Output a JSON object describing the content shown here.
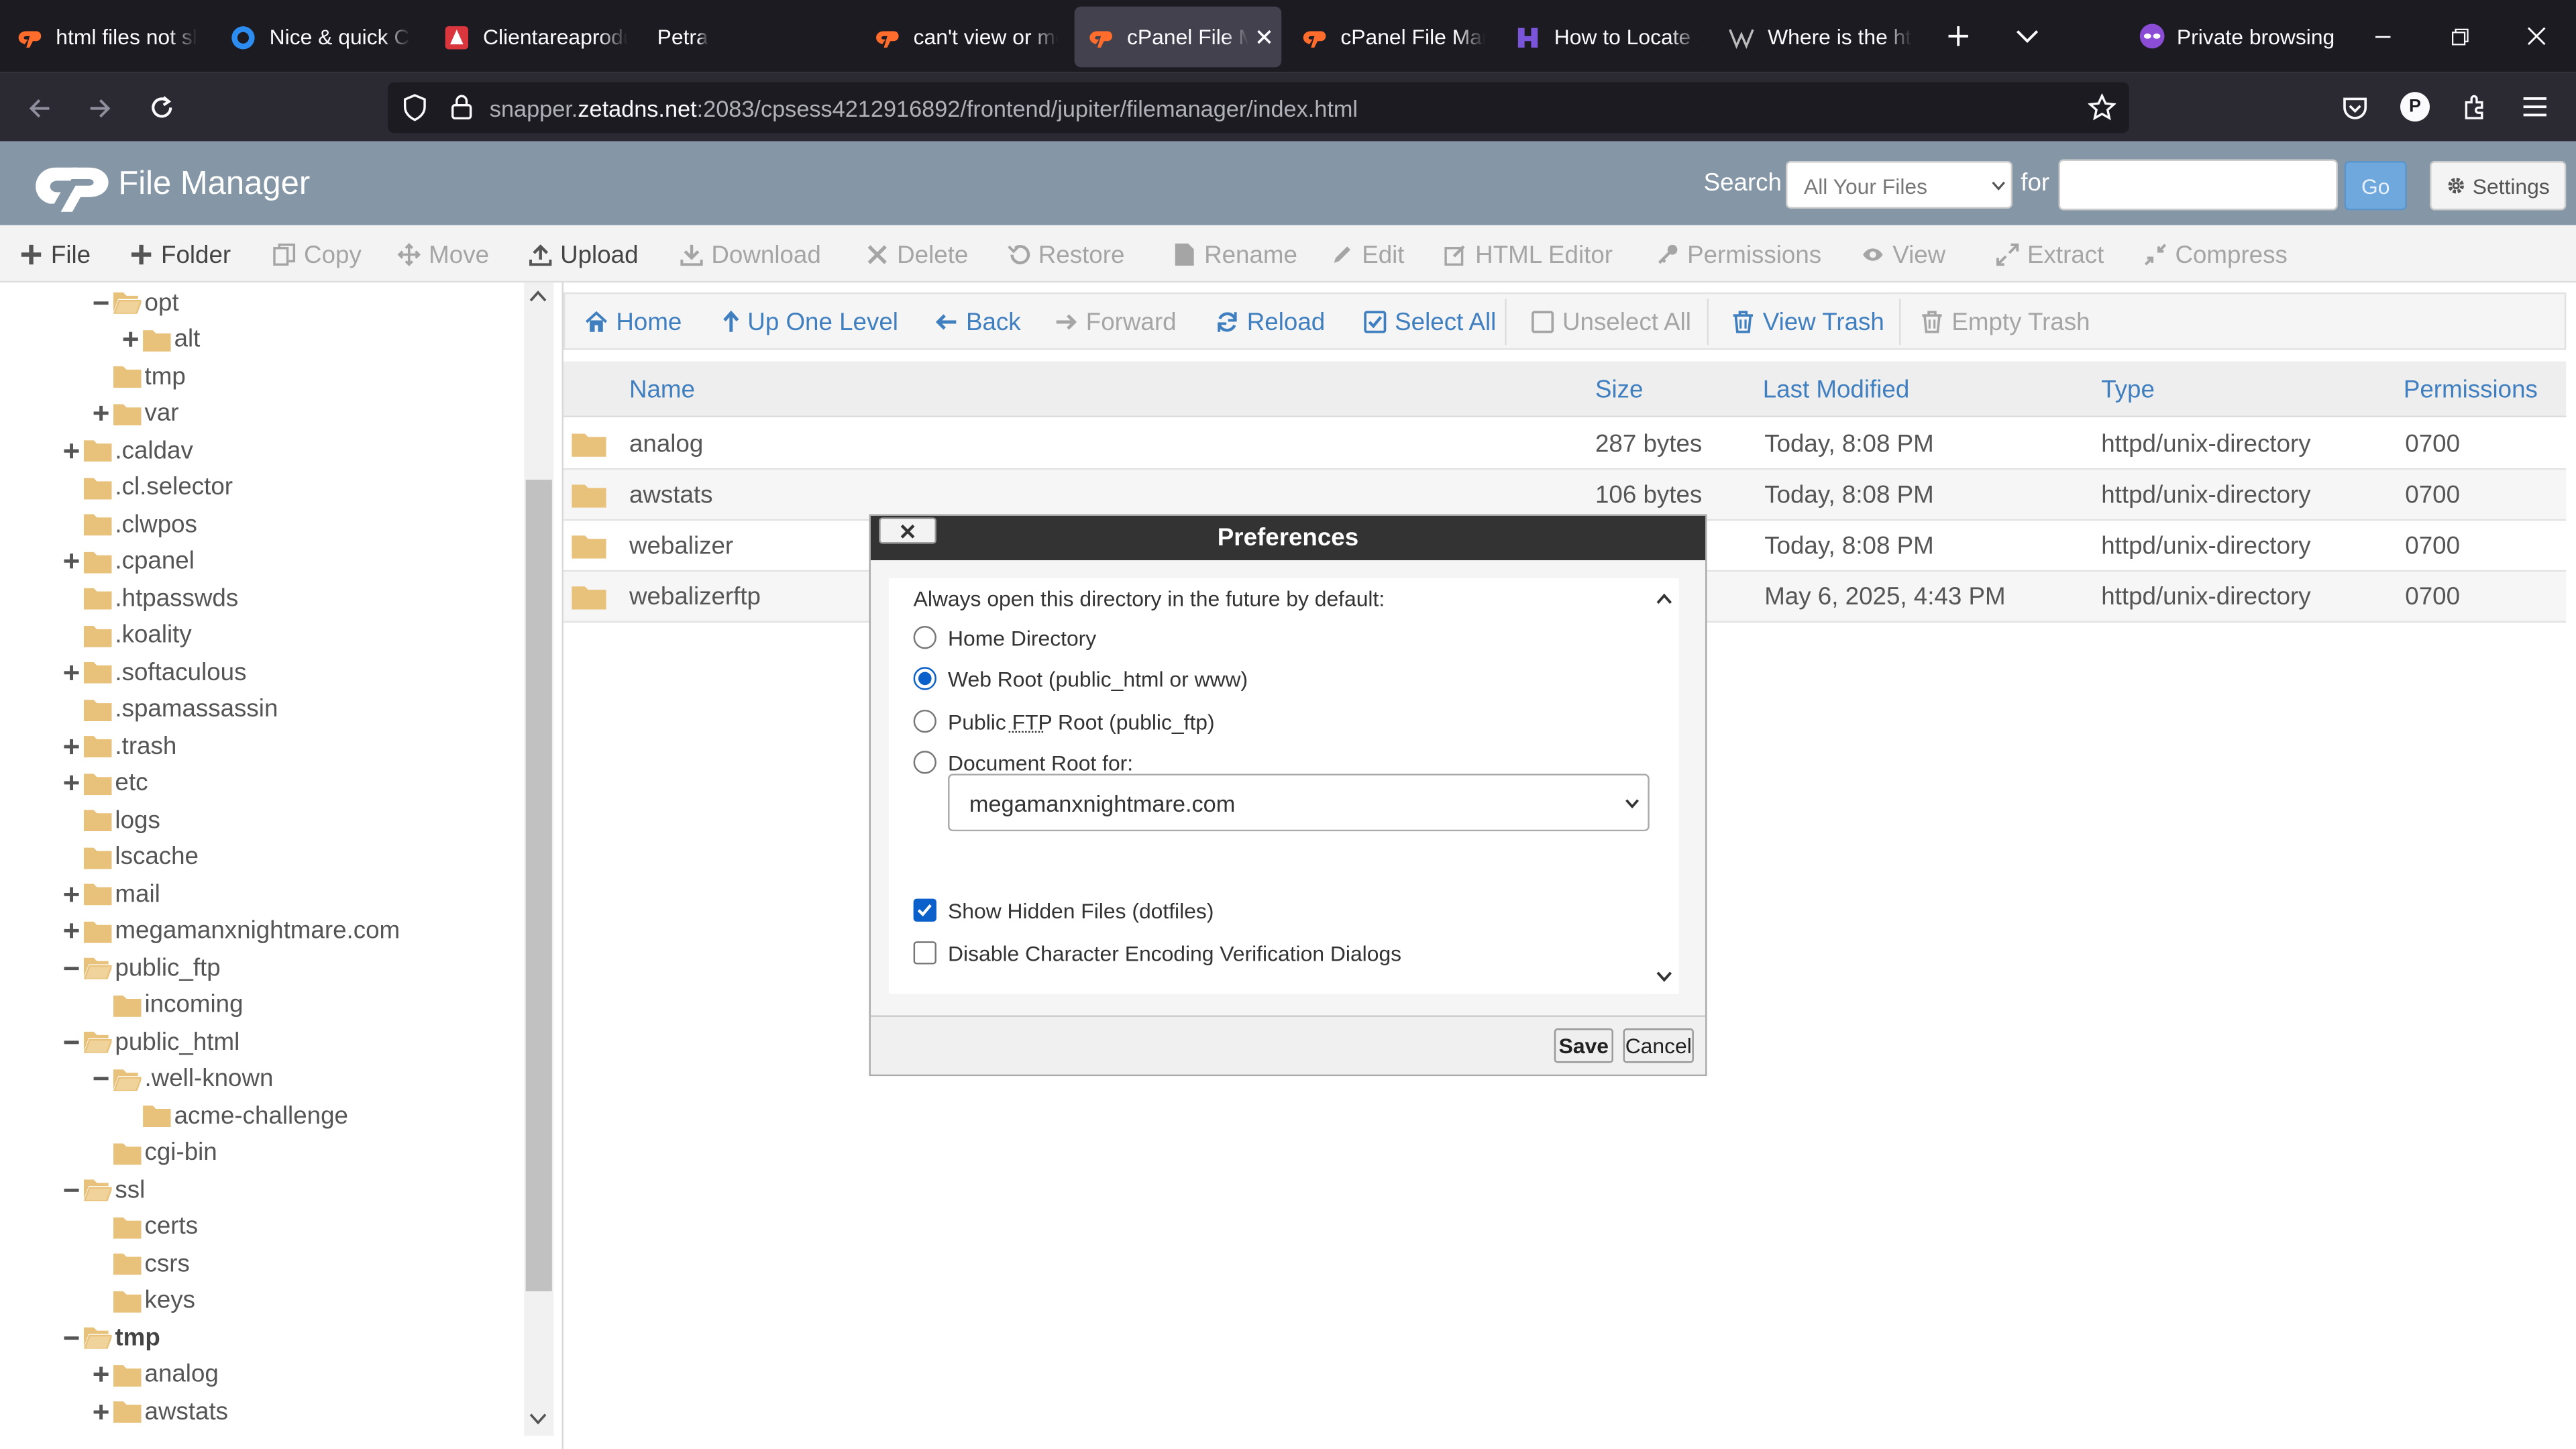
{
  "browser": {
    "tabs": [
      {
        "label": "html files not sh",
        "icon": "cpanel-icon"
      },
      {
        "label": "Nice & quick CS",
        "icon": "site-icon"
      },
      {
        "label": "Clientareaprodu",
        "icon": "site-icon"
      },
      {
        "label": "Petra",
        "icon": "none"
      },
      {
        "label": "can't view or mo",
        "icon": "cpanel-icon"
      },
      {
        "label": "cPanel File M",
        "icon": "cpanel-icon",
        "active": true
      },
      {
        "label": "cPanel File Mana",
        "icon": "cpanel-icon"
      },
      {
        "label": "How to Locate a",
        "icon": "site-icon"
      },
      {
        "label": "Where is the hta",
        "icon": "site-icon"
      }
    ],
    "private_label": "Private browsing",
    "url_host": "snapper.zetadns.net",
    "url_rest": ":2083/cpsess4212916892/frontend/jupiter/filemanager/index.html",
    "url_domain_part": "zetadns.net",
    "url_sub_part": "snapper.",
    "profile_initial": "P"
  },
  "header": {
    "title": "File Manager",
    "search_label": "Search",
    "search_scope": "All Your Files",
    "for_label": "for",
    "search_value": "",
    "go_label": "Go",
    "settings_label": "Settings"
  },
  "toolbar": {
    "file": "File",
    "folder": "Folder",
    "copy": "Copy",
    "move": "Move",
    "upload": "Upload",
    "download": "Download",
    "delete": "Delete",
    "restore": "Restore",
    "rename": "Rename",
    "edit": "Edit",
    "html_editor": "HTML Editor",
    "permissions": "Permissions",
    "view": "View",
    "extract": "Extract",
    "compress": "Compress"
  },
  "tree": [
    {
      "label": "opt",
      "indent": 2,
      "state": "open"
    },
    {
      "label": "alt",
      "indent": 3,
      "state": "closed"
    },
    {
      "label": "tmp",
      "indent": 2,
      "state": "none"
    },
    {
      "label": "var",
      "indent": 2,
      "state": "closed"
    },
    {
      "label": ".caldav",
      "indent": 1,
      "state": "closed"
    },
    {
      "label": ".cl.selector",
      "indent": 1,
      "state": "none"
    },
    {
      "label": ".clwpos",
      "indent": 1,
      "state": "none"
    },
    {
      "label": ".cpanel",
      "indent": 1,
      "state": "closed"
    },
    {
      "label": ".htpasswds",
      "indent": 1,
      "state": "none"
    },
    {
      "label": ".koality",
      "indent": 1,
      "state": "none"
    },
    {
      "label": ".softaculous",
      "indent": 1,
      "state": "closed"
    },
    {
      "label": ".spamassassin",
      "indent": 1,
      "state": "none"
    },
    {
      "label": ".trash",
      "indent": 1,
      "state": "closed"
    },
    {
      "label": "etc",
      "indent": 1,
      "state": "closed"
    },
    {
      "label": "logs",
      "indent": 1,
      "state": "none"
    },
    {
      "label": "lscache",
      "indent": 1,
      "state": "none"
    },
    {
      "label": "mail",
      "indent": 1,
      "state": "closed"
    },
    {
      "label": "megamanxnightmare.com",
      "indent": 1,
      "state": "closed"
    },
    {
      "label": "public_ftp",
      "indent": 1,
      "state": "open"
    },
    {
      "label": "incoming",
      "indent": 2,
      "state": "none"
    },
    {
      "label": "public_html",
      "indent": 1,
      "state": "open"
    },
    {
      "label": ".well-known",
      "indent": 2,
      "state": "open"
    },
    {
      "label": "acme-challenge",
      "indent": 3,
      "state": "none"
    },
    {
      "label": "cgi-bin",
      "indent": 2,
      "state": "none"
    },
    {
      "label": "ssl",
      "indent": 1,
      "state": "open"
    },
    {
      "label": "certs",
      "indent": 2,
      "state": "none"
    },
    {
      "label": "csrs",
      "indent": 2,
      "state": "none"
    },
    {
      "label": "keys",
      "indent": 2,
      "state": "none"
    },
    {
      "label": "tmp",
      "indent": 1,
      "state": "open",
      "bold": true
    },
    {
      "label": "analog",
      "indent": 2,
      "state": "closed"
    },
    {
      "label": "awstats",
      "indent": 2,
      "state": "closed"
    }
  ],
  "filenav": {
    "home": "Home",
    "up": "Up One Level",
    "back": "Back",
    "forward": "Forward",
    "reload": "Reload",
    "select_all": "Select All",
    "unselect_all": "Unselect All",
    "view_trash": "View Trash",
    "empty_trash": "Empty Trash"
  },
  "table": {
    "columns": [
      "Name",
      "Size",
      "Last Modified",
      "Type",
      "Permissions"
    ],
    "rows": [
      {
        "name": "analog",
        "size": "287 bytes",
        "modified": "Today, 8:08 PM",
        "type": "httpd/unix-directory",
        "perms": "0700"
      },
      {
        "name": "awstats",
        "size": "106 bytes",
        "modified": "Today, 8:08 PM",
        "type": "httpd/unix-directory",
        "perms": "0700"
      },
      {
        "name": "webalizer",
        "size": "",
        "modified": "Today, 8:08 PM",
        "type": "httpd/unix-directory",
        "perms": "0700"
      },
      {
        "name": "webalizerftp",
        "size": "",
        "modified": "May 6, 2025, 4:43 PM",
        "type": "httpd/unix-directory",
        "perms": "0700"
      }
    ]
  },
  "dialog": {
    "title": "Preferences",
    "prompt": "Always open this directory in the future by default:",
    "options": [
      "Home Directory",
      "Web Root (public_html or www)",
      "Public FTP Root (public_ftp)",
      "Document Root for:"
    ],
    "selected_option": 1,
    "docroot_value": "megamanxnightmare.com",
    "show_hidden": "Show Hidden Files (dotfiles)",
    "show_hidden_checked": true,
    "disable_enc": "Disable Character Encoding Verification Dialogs",
    "disable_enc_checked": false,
    "save": "Save",
    "cancel": "Cancel"
  },
  "colors": {
    "accent_link": "#3f7fbf",
    "header_bg": "#8597a6",
    "folder": "#e8c17a",
    "dialog_header": "#333333",
    "check_blue": "#0b61c9"
  }
}
